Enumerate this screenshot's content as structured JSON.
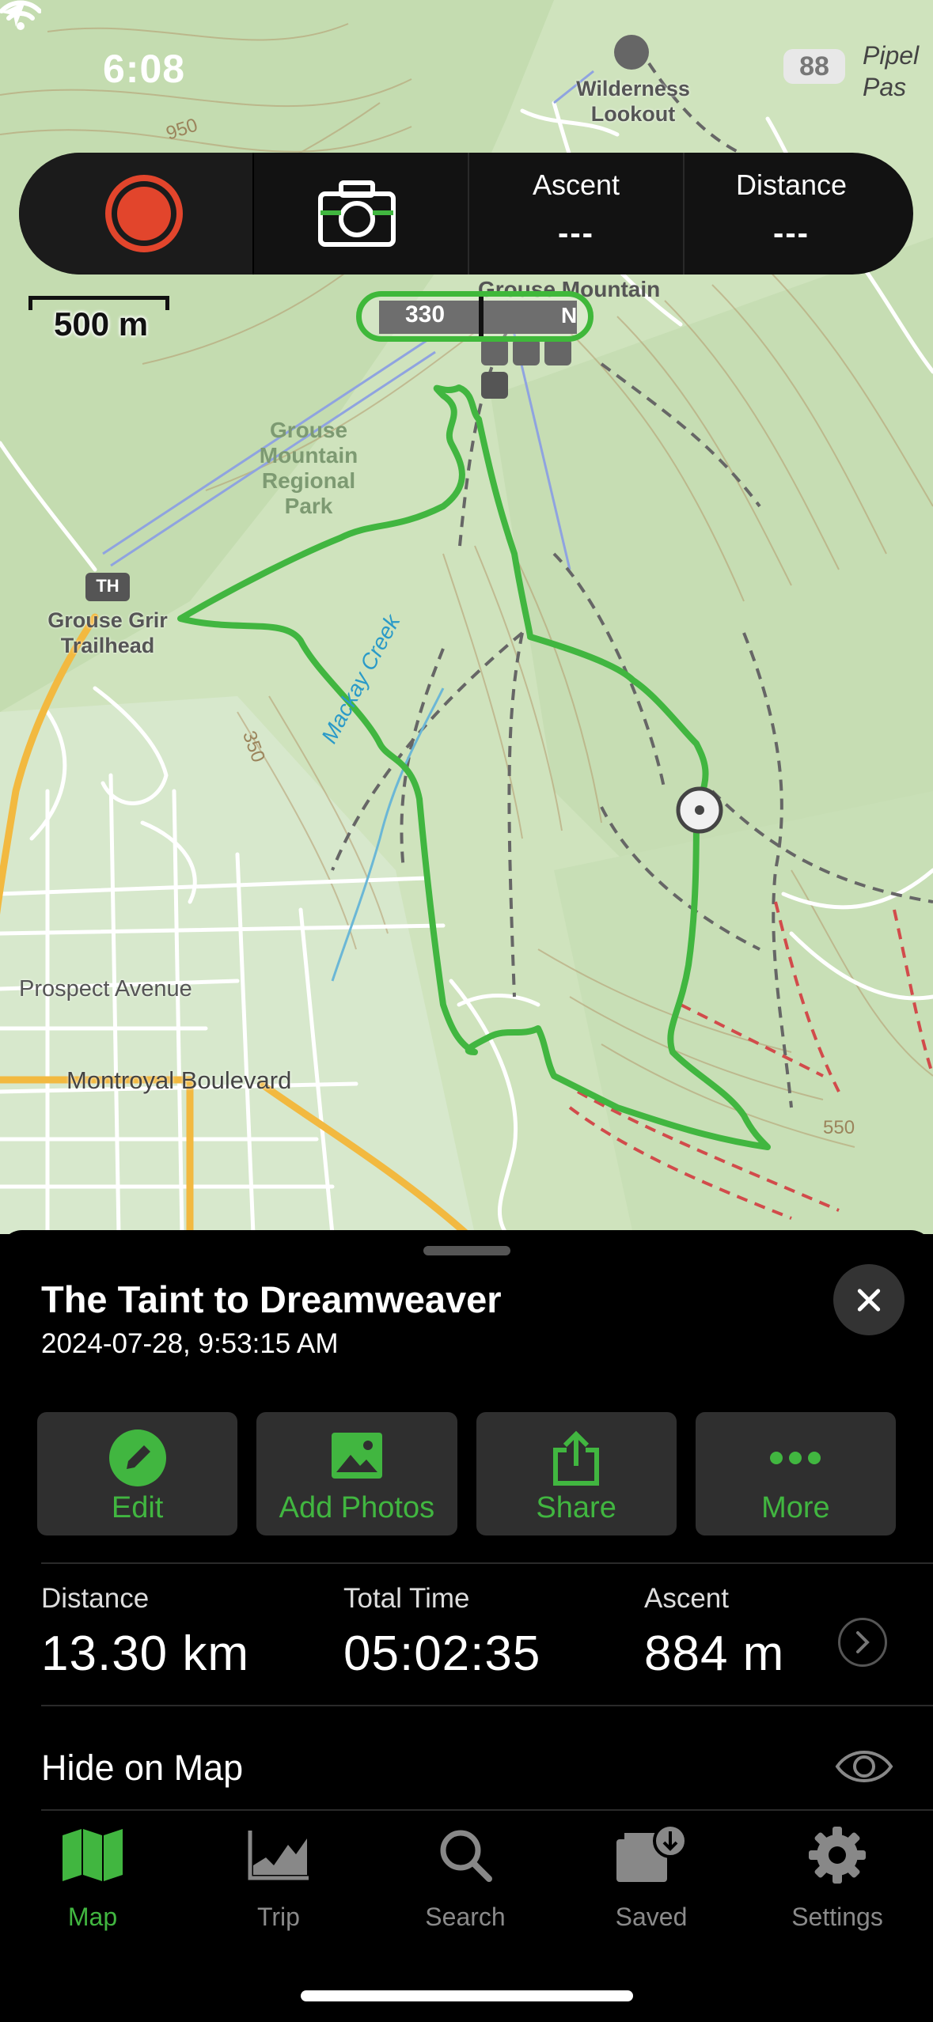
{
  "status_bar": {
    "time": "6:08",
    "battery": "88"
  },
  "map": {
    "labels": {
      "wilderness_lookout": [
        "Wilderness",
        "Lookout"
      ],
      "pipeline_pass": [
        "Pipel",
        "Pas"
      ],
      "park": [
        "Grouse",
        "Mountain",
        "Regional",
        "Park"
      ],
      "trailhead": [
        "Grouse Grir",
        "Trailhead"
      ],
      "creek": "Mackay Creek",
      "prospect": "Prospect Avenue",
      "montroyal": "Montroyal Boulevard",
      "grouse_mountain": "Grouse Mountain",
      "th_badge": "TH",
      "contour_950": "950",
      "contour_350": "350",
      "contour_550": "550"
    },
    "scale_label": "500 m",
    "compass": {
      "heading": "330",
      "north": "N"
    },
    "route_color": "#41b640"
  },
  "record_bar": {
    "ascent_label": "Ascent",
    "ascent_value": "---",
    "distance_label": "Distance",
    "distance_value": "---"
  },
  "trip": {
    "title": "The Taint to Dreamweaver",
    "datetime": "2024-07-28, 9:53:15 AM",
    "actions": [
      {
        "label": "Edit",
        "icon": "pencil-icon"
      },
      {
        "label": "Add Photos",
        "icon": "photo-icon"
      },
      {
        "label": "Share",
        "icon": "share-icon"
      },
      {
        "label": "More",
        "icon": "more-icon"
      }
    ],
    "stats": [
      {
        "label": "Distance",
        "value": "13.30 km"
      },
      {
        "label": "Total Time",
        "value": "05:02:35"
      },
      {
        "label": "Ascent",
        "value": "884 m"
      }
    ],
    "hide_label": "Hide on Map"
  },
  "tabs": [
    {
      "label": "Map",
      "icon": "map-icon",
      "active": true
    },
    {
      "label": "Trip",
      "icon": "chart-icon",
      "active": false
    },
    {
      "label": "Search",
      "icon": "search-icon",
      "active": false
    },
    {
      "label": "Saved",
      "icon": "saved-icon",
      "active": false
    },
    {
      "label": "Settings",
      "icon": "gear-icon",
      "active": false
    }
  ],
  "colors": {
    "accent": "#41b640",
    "record": "#e2452c",
    "map_bg": "#cfe3c0"
  }
}
